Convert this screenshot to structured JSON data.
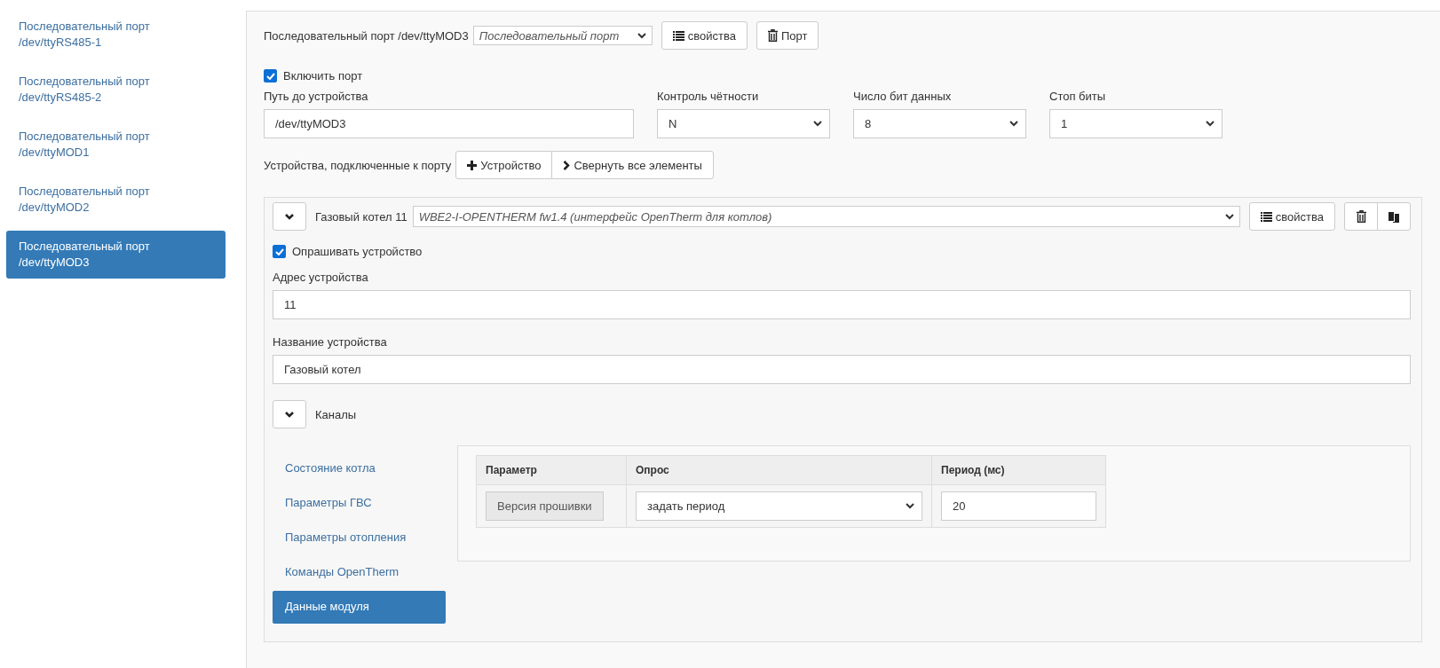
{
  "sidebar": {
    "items": [
      {
        "title": "Последовательный порт",
        "path": "/dev/ttyRS485-1",
        "selected": false
      },
      {
        "title": "Последовательный порт",
        "path": "/dev/ttyRS485-2",
        "selected": false
      },
      {
        "title": "Последовательный порт",
        "path": "/dev/ttyMOD1",
        "selected": false
      },
      {
        "title": "Последовательный порт",
        "path": "/dev/ttyMOD2",
        "selected": false
      },
      {
        "title": "Последовательный порт",
        "path": "/dev/ttyMOD3",
        "selected": true
      }
    ]
  },
  "port": {
    "title": "Последовательный порт /dev/ttyMOD3",
    "type_select": "Последовательный порт",
    "properties_button": "свойства",
    "delete_button": "Порт",
    "enable": {
      "label": "Включить порт",
      "checked": true
    },
    "fields": [
      {
        "kind": "text",
        "label": "Путь до устройства",
        "value": "/dev/ttyMOD3"
      },
      {
        "kind": "select",
        "label": "Контроль чётности",
        "value": "N"
      },
      {
        "kind": "select",
        "label": "Число бит данных",
        "value": "8"
      },
      {
        "kind": "select",
        "label": "Стоп биты",
        "value": "1"
      }
    ],
    "devices_label": "Устройства, подключенные к порту",
    "add_device_button": "Устройство",
    "collapse_all_button": "Свернуть все элементы"
  },
  "device": {
    "expanded": true,
    "name": "Газовый котел 11",
    "template": "WBE2-I-OPENTHERM fw1.4 (интерфейс OpenTherm для котлов)",
    "properties_button": "свойства",
    "poll": {
      "label": "Опрашивать устройство",
      "checked": true
    },
    "fields": [
      {
        "label": "Адрес устройства",
        "value": "11"
      },
      {
        "label": "Название устройства",
        "value": "Газовый котел"
      }
    ],
    "channels": {
      "label": "Каналы",
      "expanded": true,
      "tabs": [
        {
          "label": "Состояние котла",
          "selected": false
        },
        {
          "label": "Параметры ГВС",
          "selected": false
        },
        {
          "label": "Параметры отопления",
          "selected": false
        },
        {
          "label": "Команды OpenTherm",
          "selected": false
        },
        {
          "label": "Данные модуля",
          "selected": true
        }
      ],
      "table": {
        "columns": [
          "Параметр",
          "Опрос",
          "Период (мс)"
        ],
        "rows": [
          {
            "parameter": "Версия прошивки",
            "poll": "задать период",
            "period": "20"
          }
        ]
      }
    }
  }
}
